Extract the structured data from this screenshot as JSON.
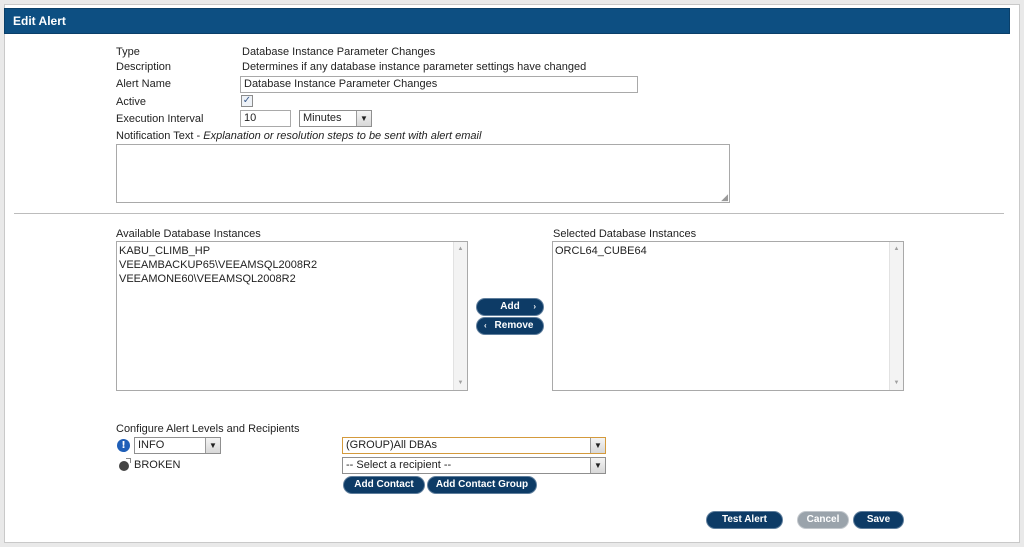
{
  "title": "Edit Alert",
  "fields": {
    "type_label": "Type",
    "type_value": "Database Instance Parameter Changes",
    "description_label": "Description",
    "description_value": "Determines if any database instance parameter settings have changed",
    "alert_name_label": "Alert Name",
    "alert_name_value": "Database Instance Parameter Changes",
    "active_label": "Active",
    "active_checked": true,
    "execution_interval_label": "Execution Interval",
    "execution_interval_value": "10",
    "interval_unit": "Minutes",
    "notification_label": "Notification Text - ",
    "notification_hint": "Explanation or resolution steps to be sent with alert email",
    "notification_value": ""
  },
  "instances": {
    "available_label": "Available Database Instances",
    "available": [
      "KABU_CLIMB_HP",
      "VEEAMBACKUP65\\VEEAMSQL2008R2",
      "VEEAMONE60\\VEEAMSQL2008R2"
    ],
    "selected_label": "Selected Database Instances",
    "selected": [
      "ORCL64_CUBE64"
    ],
    "add_label": "Add",
    "remove_label": "Remove"
  },
  "levels": {
    "section_label": "Configure Alert Levels and Recipients",
    "info_level": "INFO",
    "broken_level": "BROKEN",
    "recipient_1": "(GROUP)All DBAs",
    "recipient_2": "-- Select a recipient --",
    "add_contact_label": "Add Contact",
    "add_contact_group_label": "Add Contact Group"
  },
  "actions": {
    "test_label": "Test Alert",
    "cancel_label": "Cancel",
    "save_label": "Save"
  },
  "icons": {
    "info": "info-icon",
    "broken": "bomb-icon",
    "dropdown": "chevron-down-icon",
    "add": "chevron-right-icon",
    "remove": "chevron-left-icon"
  },
  "colors": {
    "titlebar": "#0d4f82",
    "button": "#0d3b66",
    "cancel_button": "#9aa3ab"
  }
}
